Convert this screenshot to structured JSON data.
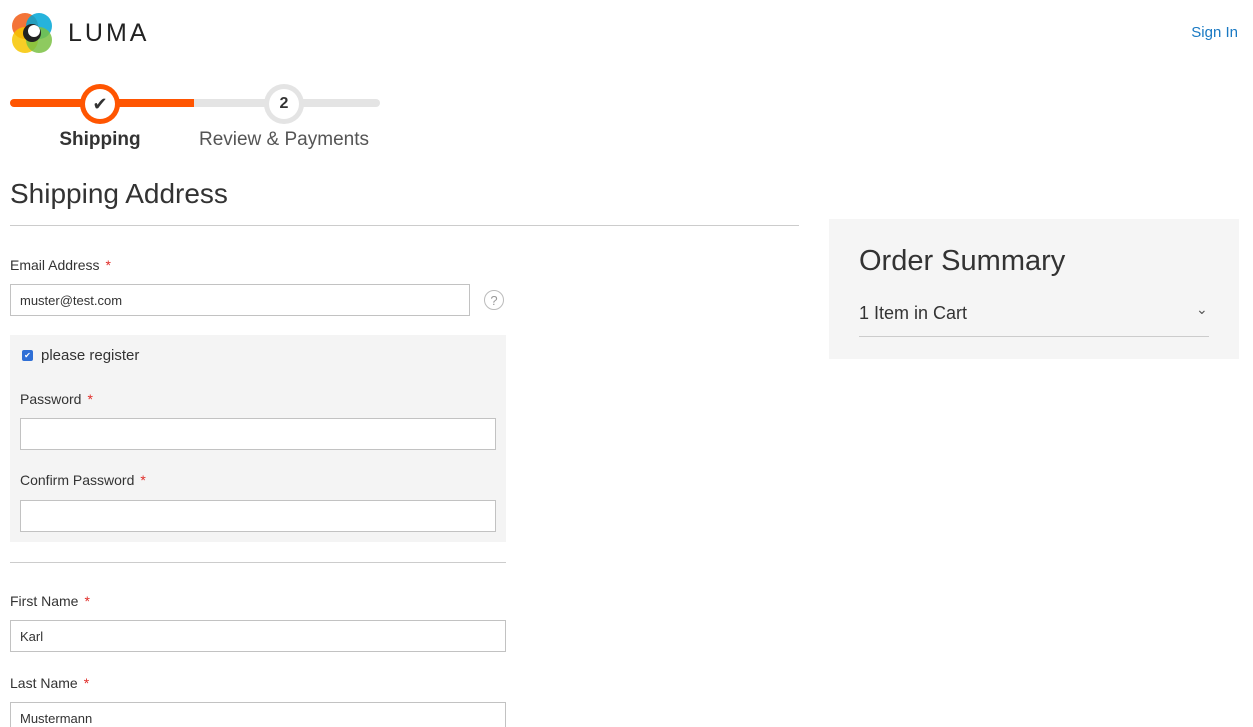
{
  "header": {
    "brand": "LUMA",
    "sign_in": "Sign In"
  },
  "progress": {
    "steps": [
      {
        "label": "Shipping",
        "marker": "✔",
        "state": "complete"
      },
      {
        "label": "Review & Payments",
        "marker": "2",
        "state": "pending"
      }
    ],
    "accent_color": "#ff5501"
  },
  "shipping": {
    "title": "Shipping Address",
    "email_label": "Email Address",
    "email_value": "muster@test.com",
    "help_glyph": "?",
    "register_label": "please register",
    "register_checked": true,
    "password_label": "Password",
    "password_value": "",
    "confirm_password_label": "Confirm Password",
    "confirm_password_value": "",
    "first_name_label": "First Name",
    "first_name_value": "Karl",
    "last_name_label": "Last Name",
    "last_name_value": "Mustermann",
    "required_mark": "*"
  },
  "summary": {
    "title": "Order Summary",
    "items_in_cart": "1 Item in Cart",
    "chevron": "⌄"
  }
}
